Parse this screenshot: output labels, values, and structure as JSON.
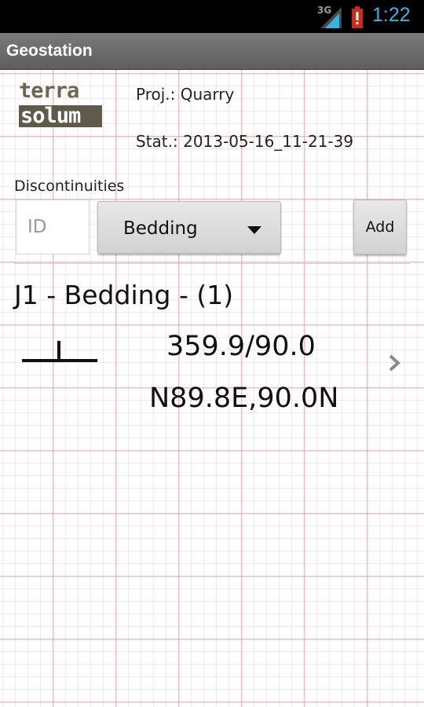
{
  "status_bar": {
    "network_type": "3G",
    "signal_icon": "signal-icon",
    "battery_icon": "battery-alert-icon",
    "time": "1:22",
    "time_color": "#33b5e5"
  },
  "app_bar": {
    "title": "Geostation"
  },
  "header": {
    "logo": {
      "line1": "terra",
      "line2": "solum"
    },
    "project": "Proj.: Quarry",
    "station": "Stat.: 2013-05-16_11-21-39"
  },
  "discontinuities": {
    "section_label": "Discontinuities",
    "id_input": {
      "placeholder": "ID",
      "value": ""
    },
    "type_select": {
      "selected": "Bedding"
    },
    "add_button": "Add"
  },
  "entries": [
    {
      "title": "J1 - Bedding - (1)",
      "symbol_icon": "strike-dip-symbol-icon",
      "dip_direction": "359.9/90.0",
      "strike": "N89.8E,90.0N",
      "chevron_icon": "chevron-right-icon"
    }
  ]
}
